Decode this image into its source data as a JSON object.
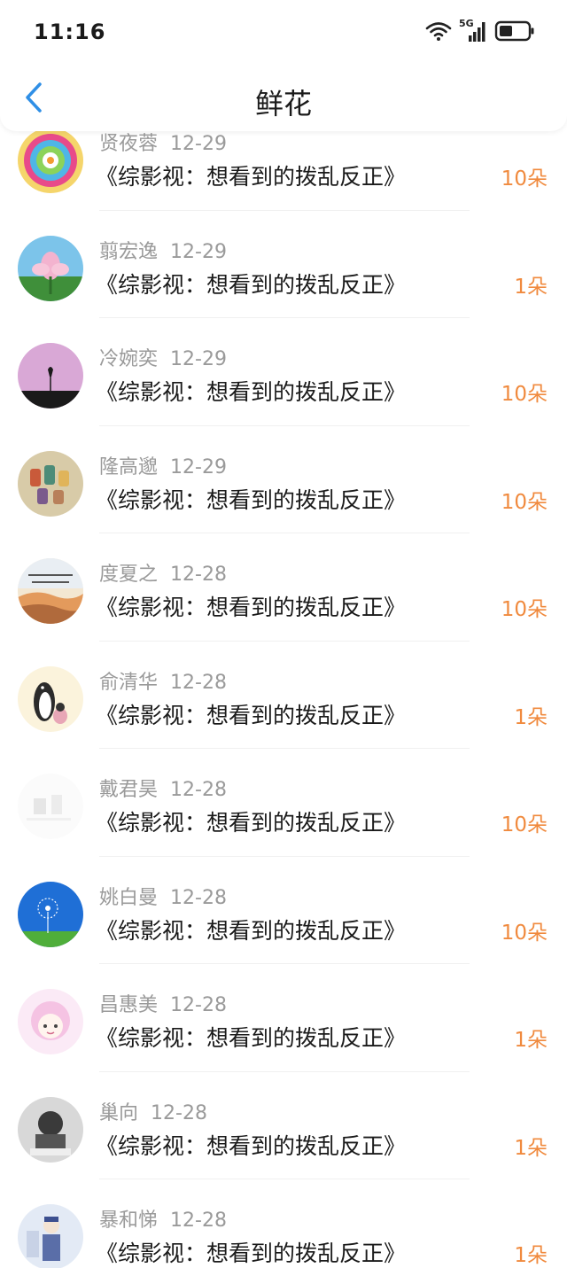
{
  "status_bar": {
    "time": "11:16",
    "network_label": "5G",
    "icons": [
      "wifi-icon",
      "signal-icon",
      "battery-icon"
    ]
  },
  "title_bar": {
    "back_icon": "chevron-left-icon",
    "title": "鲜花"
  },
  "colors": {
    "accent_blue": "#2f8fe6",
    "amount_orange": "#f08a3e",
    "meta_gray": "#9a9a9a"
  },
  "items": [
    {
      "name": "贤夜蓉",
      "date": "12-29",
      "book": "《综影视：想看到的拨乱反正》",
      "amount": "10朵"
    },
    {
      "name": "翦宏逸",
      "date": "12-29",
      "book": "《综影视：想看到的拨乱反正》",
      "amount": "1朵"
    },
    {
      "name": "冷婉奕",
      "date": "12-29",
      "book": "《综影视：想看到的拨乱反正》",
      "amount": "10朵"
    },
    {
      "name": "隆高邈",
      "date": "12-29",
      "book": "《综影视：想看到的拨乱反正》",
      "amount": "10朵"
    },
    {
      "name": "度夏之",
      "date": "12-28",
      "book": "《综影视：想看到的拨乱反正》",
      "amount": "10朵"
    },
    {
      "name": "俞清华",
      "date": "12-28",
      "book": "《综影视：想看到的拨乱反正》",
      "amount": "1朵"
    },
    {
      "name": "戴君昊",
      "date": "12-28",
      "book": "《综影视：想看到的拨乱反正》",
      "amount": "10朵"
    },
    {
      "name": "姚白曼",
      "date": "12-28",
      "book": "《综影视：想看到的拨乱反正》",
      "amount": "10朵"
    },
    {
      "name": "昌惠美",
      "date": "12-28",
      "book": "《综影视：想看到的拨乱反正》",
      "amount": "1朵"
    },
    {
      "name": "巢向",
      "date": "12-28",
      "book": "《综影视：想看到的拨乱反正》",
      "amount": "1朵"
    },
    {
      "name": "暴和悌",
      "date": "12-28",
      "book": "《综影视：想看到的拨乱反正》",
      "amount": "1朵"
    }
  ]
}
